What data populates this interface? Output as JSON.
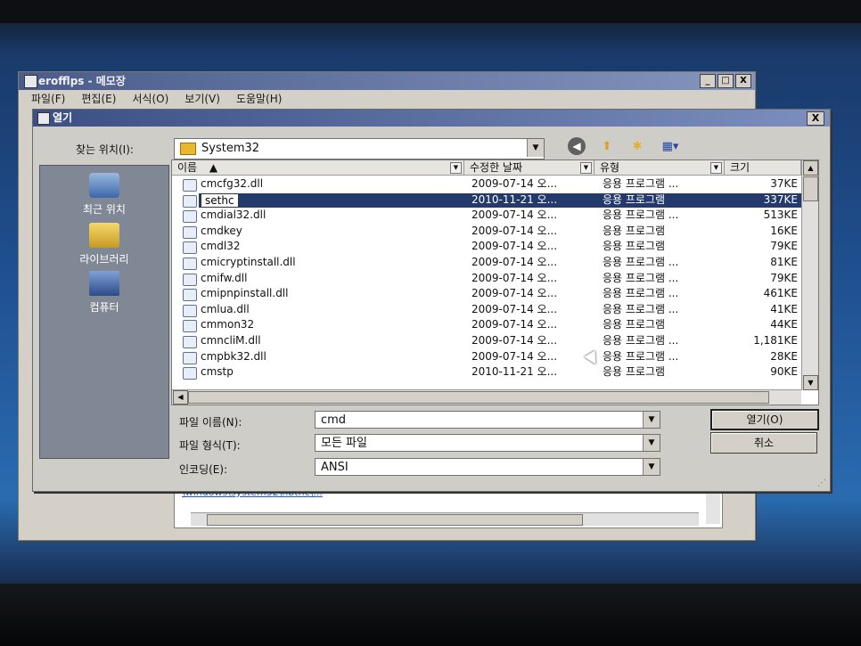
{
  "notepad": {
    "title": "erofflps - 메모장",
    "menu": [
      "파일(F)",
      "편집(E)",
      "서식(O)",
      "보기(V)",
      "도움말(H)"
    ],
    "controls": [
      "_",
      "□",
      "X"
    ],
    "text_line": "\\windows\\system32\\nbtnc\\..."
  },
  "dialog": {
    "title": "열기",
    "close": "X",
    "lookin_label": "찾는 위치(I):",
    "lookin_value": "System32",
    "toolbar_icons": [
      "back-icon",
      "up-folder-icon",
      "new-folder-icon",
      "view-menu-icon"
    ],
    "places": [
      {
        "label": "최근 위치",
        "icon": "recent-places-icon"
      },
      {
        "label": "라이브러리",
        "icon": "libraries-icon"
      },
      {
        "label": "컴퓨터",
        "icon": "computer-icon"
      }
    ],
    "columns": {
      "name": "이름",
      "date": "수정한 날짜",
      "type": "유형",
      "size": "크기"
    },
    "files": [
      {
        "name": "cmcfg32.dll",
        "date": "2009-07-14 오...",
        "type": "응용 프로그램 ...",
        "size": "37KE"
      },
      {
        "name": "sethc",
        "date": "2010-11-21 오...",
        "type": "응용 프로그램",
        "size": "337KE"
      },
      {
        "name": "cmdial32.dll",
        "date": "2009-07-14 오...",
        "type": "응용 프로그램 ...",
        "size": "513KE"
      },
      {
        "name": "cmdkey",
        "date": "2009-07-14 오...",
        "type": "응용 프로그램",
        "size": "16KE"
      },
      {
        "name": "cmdl32",
        "date": "2009-07-14 오...",
        "type": "응용 프로그램",
        "size": "79KE"
      },
      {
        "name": "cmicryptinstall.dll",
        "date": "2009-07-14 오...",
        "type": "응용 프로그램 ...",
        "size": "81KE"
      },
      {
        "name": "cmifw.dll",
        "date": "2009-07-14 오...",
        "type": "응용 프로그램 ...",
        "size": "79KE"
      },
      {
        "name": "cmipnpinstall.dll",
        "date": "2009-07-14 오...",
        "type": "응용 프로그램 ...",
        "size": "461KE"
      },
      {
        "name": "cmlua.dll",
        "date": "2009-07-14 오...",
        "type": "응용 프로그램 ...",
        "size": "41KE"
      },
      {
        "name": "cmmon32",
        "date": "2009-07-14 오...",
        "type": "응용 프로그램",
        "size": "44KE"
      },
      {
        "name": "cmncliM.dll",
        "date": "2009-07-14 오...",
        "type": "응용 프로그램 ...",
        "size": "1,181KE"
      },
      {
        "name": "cmpbk32.dll",
        "date": "2009-07-14 오...",
        "type": "응용 프로그램 ...",
        "size": "28KE"
      },
      {
        "name": "cmstp",
        "date": "2010-11-21 오...",
        "type": "응용 프로그램",
        "size": "90KE"
      }
    ],
    "filename_label": "파일 이름(N):",
    "filename_value": "cmd",
    "filetype_label": "파일 형식(T):",
    "filetype_value": "모든 파일",
    "encoding_label": "인코딩(E):",
    "encoding_value": "ANSI",
    "open_button": "열기(O)",
    "cancel_button": "취소"
  }
}
